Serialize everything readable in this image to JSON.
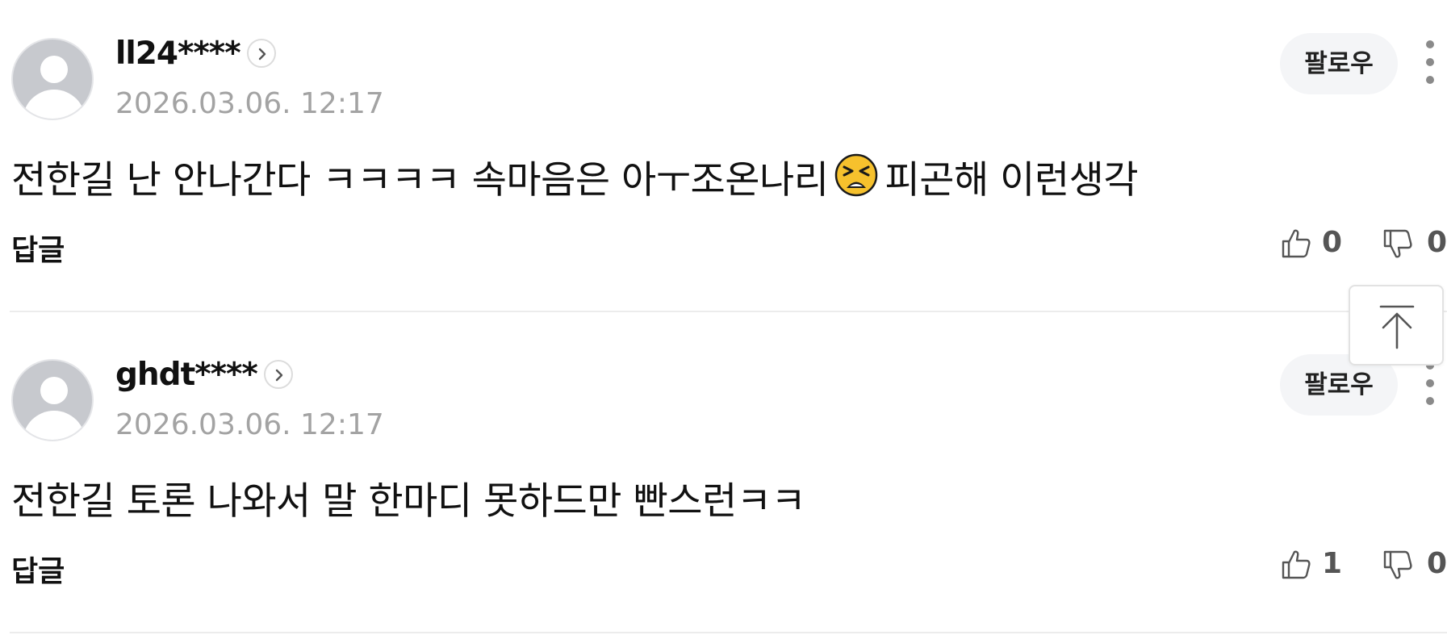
{
  "comments": [
    {
      "username": "ll24****",
      "date": "2026.03.06. 12:17",
      "follow_label": "팔로우",
      "content_before_emoji": "전한길 난 안나간다 ㅋㅋㅋㅋ 속마음은 아ㅜ조온나리",
      "emoji_icon": "tired-face-emoji",
      "content_after_emoji": "피곤해 이런생각",
      "reply_label": "답글",
      "likes": "0",
      "dislikes": "0"
    },
    {
      "username": "ghdt****",
      "date": "2026.03.06. 12:17",
      "follow_label": "팔로우",
      "content": "전한길 토론 나와서 말 한마디 못하드만 빤스런ㅋㅋ",
      "reply_label": "답글",
      "likes": "1",
      "dislikes": "0"
    }
  ],
  "icons": {
    "avatar": "default-profile-avatar",
    "profile_link": "chevron-right-icon",
    "more": "more-vertical-icon",
    "like": "thumbs-up-icon",
    "dislike": "thumbs-down-icon",
    "scroll_top": "arrow-up-to-top-icon"
  },
  "colors": {
    "avatar_bg": "#c7c9ce",
    "date_text": "#a3a3a3",
    "follow_bg": "#f4f5f7",
    "divider": "#ececec",
    "emoji_face": "#f6c12d"
  }
}
